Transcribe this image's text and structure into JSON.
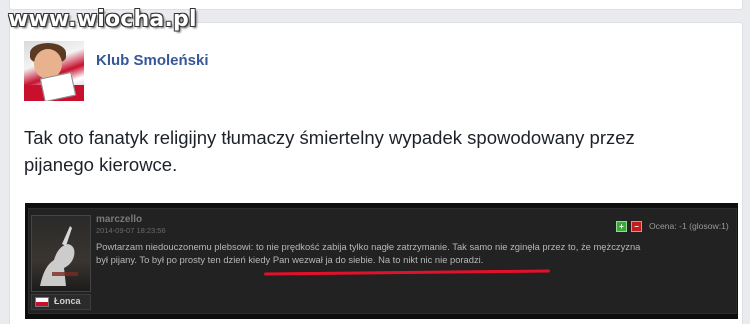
{
  "watermark": "www.wiocha.pl",
  "post": {
    "page_name": "Klub Smoleński",
    "text": "Tak oto fanatyk religijny tłumaczy śmiertelny wypadek spowodowany przez pijanego kierowce."
  },
  "comment": {
    "username": "marczello",
    "date": "2014-09-07 18:23:56",
    "rank_label": "Łonca",
    "body_lines": [
      "Powtarzam niedouczonemu plebsowi: to nie prędkość zabija tylko nagłe zatrzymanie. Tak samo nie zginęła przez to, że mężczyzna",
      "był pijany. To był po prosty ten dzień kiedy Pan wezwał ja do siebie. Na to nikt nic nie poradzi."
    ],
    "vote_up_symbol": "+",
    "vote_down_symbol": "−",
    "rating": "Ocena: -1 (glosow:1)"
  },
  "colors": {
    "page_name": "#365899",
    "underline": "#e2112a",
    "vote_up": "#3aa83a",
    "vote_down": "#c21d1d"
  },
  "icons": [
    "flag-icon",
    "avatar-image",
    "vote-up-icon",
    "vote-down-icon"
  ]
}
